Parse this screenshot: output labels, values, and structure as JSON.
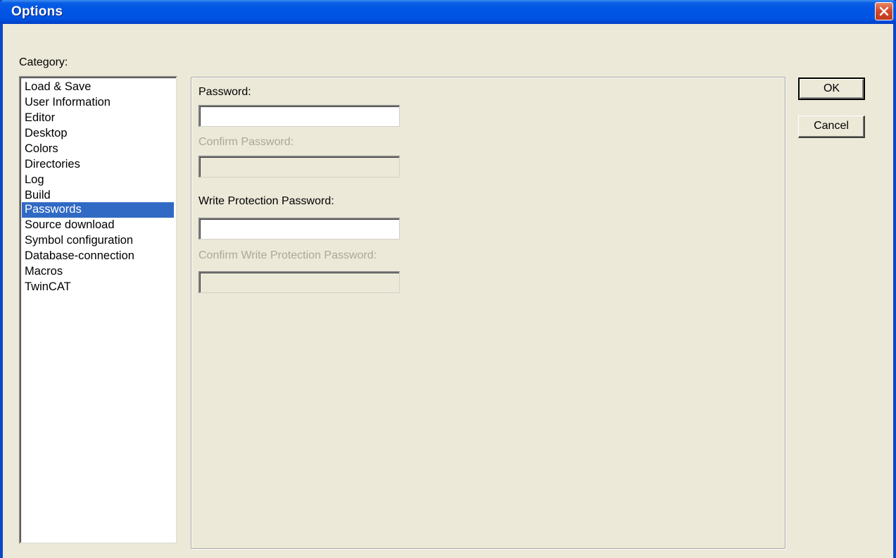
{
  "window": {
    "title": "Options",
    "close_icon": "close-x-icon"
  },
  "category": {
    "label": "Category:",
    "items": [
      "Load & Save",
      "User Information",
      "Editor",
      "Desktop",
      "Colors",
      "Directories",
      "Log",
      "Build",
      "Passwords",
      "Source download",
      "Symbol configuration",
      "Database-connection",
      "Macros",
      "TwinCAT"
    ],
    "selected": "Passwords"
  },
  "passwords": {
    "password_label": "Password:",
    "password_value": "",
    "confirm_password_label": "Confirm Password:",
    "confirm_password_value": "",
    "write_protection_label": "Write Protection Password:",
    "write_protection_value": "",
    "confirm_write_protection_label": "Confirm Write Protection Password:",
    "confirm_write_protection_value": ""
  },
  "buttons": {
    "ok_label": "OK",
    "cancel_label": "Cancel"
  },
  "colors": {
    "titlebar": "#0054e3",
    "dialog_background": "#ece9d8",
    "selection": "#316ac5",
    "disabled_text": "#aca899"
  }
}
